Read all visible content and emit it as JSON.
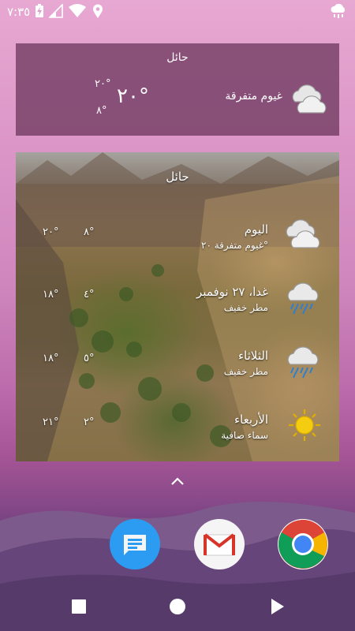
{
  "status_bar": {
    "time": "٧:٣٥",
    "icons": [
      "battery-charging-icon",
      "signal-icon",
      "wifi-icon",
      "location-icon",
      "weather-notification-icon"
    ]
  },
  "widget_current": {
    "city": "حائل",
    "temp": "٢٠°",
    "high": "٢٠°",
    "low": "٨°",
    "description": "غيوم متفرقة",
    "icon": "partly-cloudy-icon"
  },
  "widget_forecast": {
    "city": "حائل",
    "days": [
      {
        "name": "اليوم",
        "description": "غيوم متفرقة ٢٠°",
        "high": "٢٠°",
        "low": "٨°",
        "icon": "clouds-icon"
      },
      {
        "name": "غدا، ٢٧ نوفمبر",
        "description": "مطر خفيف",
        "high": "١٨°",
        "low": "٤°",
        "icon": "rain-icon"
      },
      {
        "name": "الثلاثاء",
        "description": "مطر خفيف",
        "high": "١٨°",
        "low": "٥°",
        "icon": "rain-icon"
      },
      {
        "name": "الأربعاء",
        "description": "سماء صافية",
        "high": "٢١°",
        "low": "٢°",
        "icon": "sun-icon"
      }
    ]
  },
  "dock": {
    "apps": [
      "messages",
      "gmail",
      "chrome"
    ]
  },
  "nav": [
    "recents",
    "home",
    "back"
  ]
}
